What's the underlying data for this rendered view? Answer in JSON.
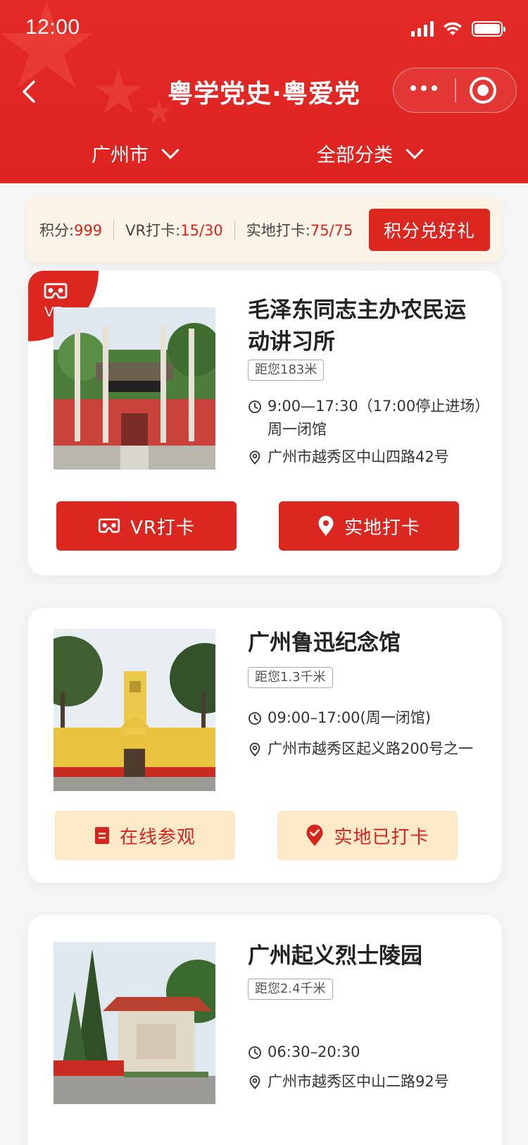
{
  "status": {
    "time": "12:00"
  },
  "nav": {
    "title": "粤学党史·粤爱党"
  },
  "filters": {
    "city": "广州市",
    "category": "全部分类"
  },
  "points": {
    "points_label": "积分:",
    "points_value": "999",
    "vr_label": "VR打卡:",
    "vr_value": "15/30",
    "onsite_label": "实地打卡:",
    "onsite_value": "75/75",
    "redeem_label": "积分兑好礼"
  },
  "cards": [
    {
      "vr_badge": "VR",
      "title": "毛泽东同志主办农民运动讲习所",
      "distance": "距您183米",
      "hours": "9:00—17:30（17:00停止进场）周一闭馆",
      "address": "广州市越秀区中山四路42号",
      "btn1": "VR打卡",
      "btn2": "实地打卡"
    },
    {
      "title": "广州鲁迅纪念馆",
      "distance": "距您1.3千米",
      "hours": "09:00–17:00(周一闭馆)",
      "address": "广州市越秀区起义路200号之一",
      "btn1": "在线参观",
      "btn2": "实地已打卡"
    },
    {
      "title": "广州起义烈士陵园",
      "distance": "距您2.4千米",
      "hours": "06:30–20:30",
      "address": "广州市越秀区中山二路92号"
    }
  ],
  "colors": {
    "primary_red": "#dc2620",
    "cream": "#fbe9c8",
    "points_bg": "#fbf3e6"
  },
  "icons": [
    "back-icon",
    "more-dots-icon",
    "target-icon",
    "chevron-down-icon",
    "vr-glasses-icon",
    "clock-icon",
    "location-pin-icon",
    "document-icon",
    "location-check-icon"
  ]
}
